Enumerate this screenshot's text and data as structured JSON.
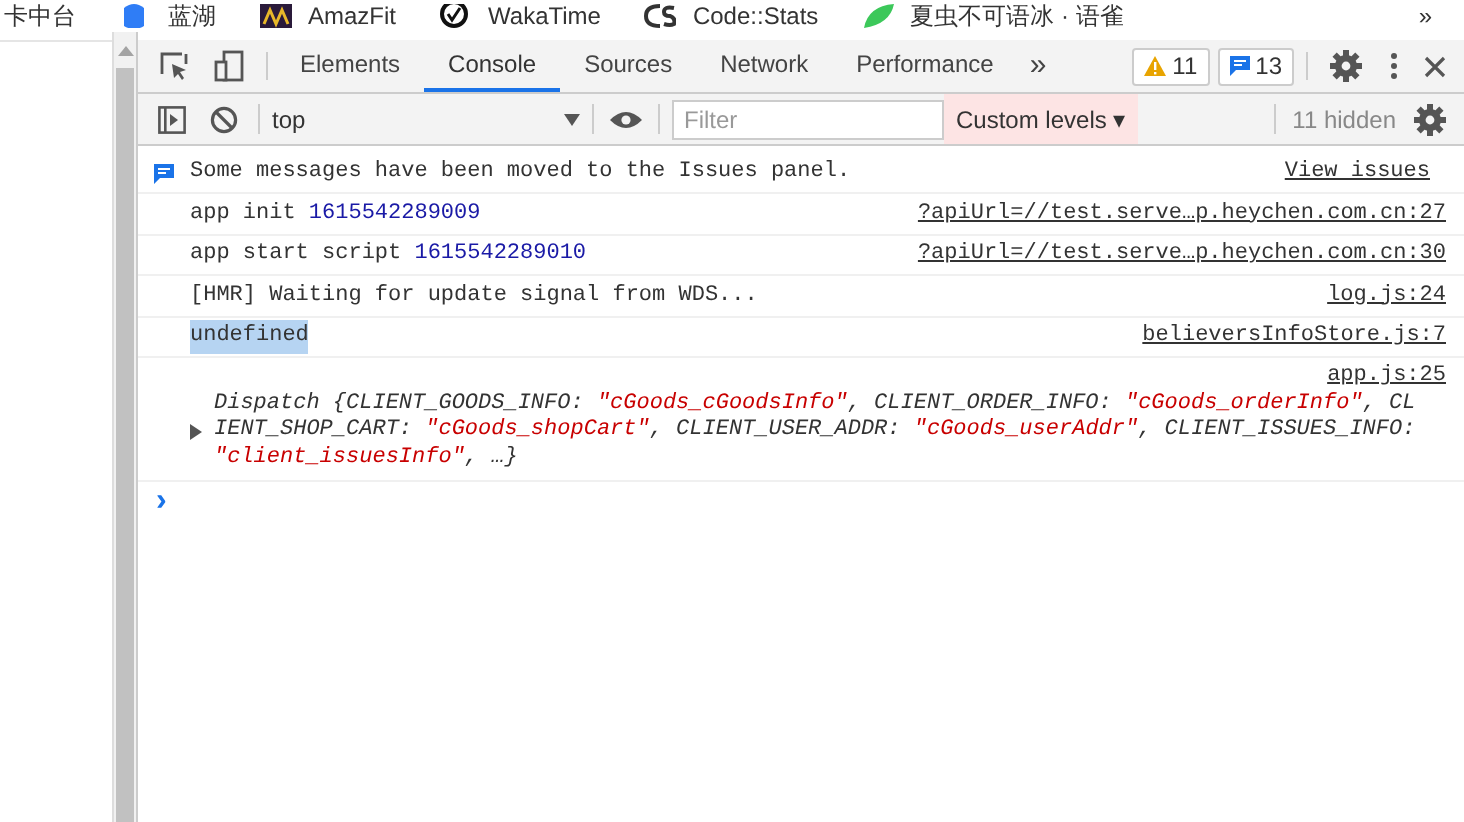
{
  "bookmarks": [
    {
      "label": "卡中台",
      "kind": "plain"
    },
    {
      "label": "蓝湖",
      "kind": "lanhu"
    },
    {
      "label": "AmazFit",
      "kind": "amazfit"
    },
    {
      "label": "WakaTime",
      "kind": "waka"
    },
    {
      "label": "Code::Stats",
      "kind": "cs"
    },
    {
      "label": "夏虫不可语冰 · 语雀",
      "kind": "yuque"
    }
  ],
  "bookmarks_more": "»",
  "tabs": [
    {
      "label": "Elements",
      "selected": false
    },
    {
      "label": "Console",
      "selected": true
    },
    {
      "label": "Sources",
      "selected": false
    },
    {
      "label": "Network",
      "selected": false
    },
    {
      "label": "Performance",
      "selected": false
    }
  ],
  "tabs_more": "»",
  "warnings": "11",
  "issues": "13",
  "toolbar": {
    "context": "top",
    "filter_placeholder": "Filter",
    "levels": "Custom levels ▾",
    "hidden": "11 hidden"
  },
  "messages": [
    {
      "kind": "info",
      "text": "Some messages have been moved to the Issues panel.",
      "link": "View issues"
    },
    {
      "kind": "log",
      "segments": [
        {
          "kind": "plain",
          "text": "app init "
        },
        {
          "kind": "number",
          "text": "1615542289009"
        }
      ],
      "link": "?apiUrl=//test.serve…p.heychen.com.cn:27",
      "highlighted": false
    },
    {
      "kind": "log",
      "segments": [
        {
          "kind": "plain",
          "text": "app start script "
        },
        {
          "kind": "number",
          "text": "1615542289010"
        }
      ],
      "link": "?apiUrl=//test.serve…p.heychen.com.cn:30",
      "highlighted": false
    },
    {
      "kind": "log",
      "segments": [
        {
          "kind": "plain",
          "text": "[HMR] Waiting for update signal from WDS..."
        }
      ],
      "link": "log.js:24",
      "highlighted": false
    },
    {
      "kind": "log",
      "segments": [
        {
          "kind": "plain",
          "text": "undefined"
        }
      ],
      "link": "believersInfoStore.js:7",
      "highlighted": true
    },
    {
      "kind": "object",
      "link": "app.js:25",
      "expanded": false,
      "lines": [
        [
          {
            "kind": "plain",
            "text": "Dispatch {CLIENT_GOODS_INFO: "
          },
          {
            "kind": "string",
            "text": "\"cGoods_cGoodsInfo\""
          },
          {
            "kind": "plain",
            "text": ", CLIENT_ORDER_INFO: "
          },
          {
            "kind": "string",
            "text": "\"cGoods_orderInfo\""
          },
          {
            "kind": "plain",
            "text": ", CL"
          }
        ],
        [
          {
            "kind": "plain",
            "text": "IENT_SHOP_CART: "
          },
          {
            "kind": "string",
            "text": "\"cGoods_shopCart\""
          },
          {
            "kind": "plain",
            "text": ", CLIENT_USER_ADDR: "
          },
          {
            "kind": "string",
            "text": "\"cGoods_userAddr\""
          },
          {
            "kind": "plain",
            "text": ", CLIENT_ISSUES_INFO:"
          }
        ],
        [
          {
            "kind": "string",
            "text": "\"client_issuesInfo\""
          },
          {
            "kind": "plain",
            "text": ", …}"
          }
        ]
      ]
    }
  ],
  "prompt": "›"
}
